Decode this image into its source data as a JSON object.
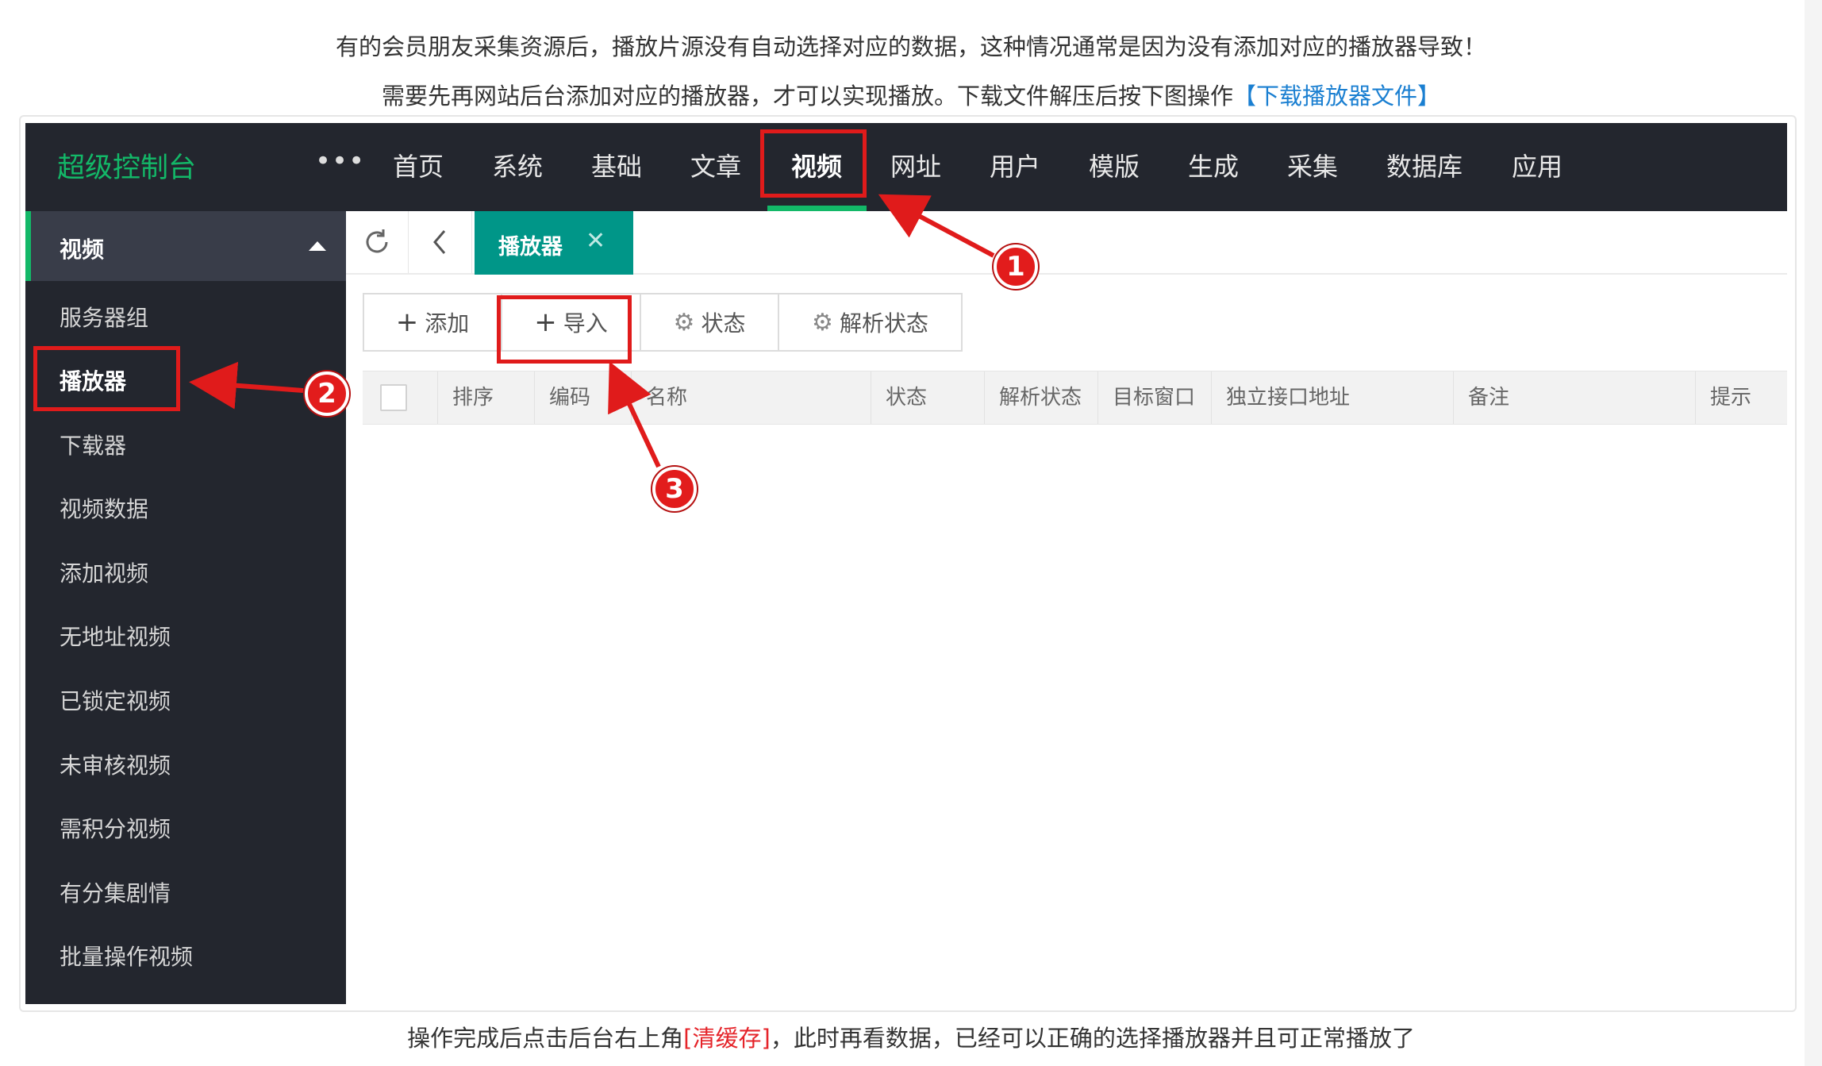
{
  "article": {
    "line1": "有的会员朋友采集资源后，播放片源没有自动选择对应的数据，这种情况通常是因为没有添加对应的播放器导致！",
    "line2_text": "需要先再网站后台添加对应的播放器，才可以实现播放。下载文件解压后按下图操作",
    "line2_link": "【下载播放器文件】",
    "outro_pre": "操作完成后点击后台右上角",
    "outro_red": "[清缓存]",
    "outro_post": "，此时再看数据，已经可以正确的选择播放器并且可正常播放了"
  },
  "header": {
    "brand": "超级控制台",
    "more": "•••",
    "nav": [
      "首页",
      "系统",
      "基础",
      "文章",
      "视频",
      "网址",
      "用户",
      "模版",
      "生成",
      "采集",
      "数据库",
      "应用"
    ],
    "active_nav": "视频"
  },
  "sidebar": {
    "section_title": "视频",
    "items": [
      "服务器组",
      "播放器",
      "下载器",
      "视频数据",
      "添加视频",
      "无地址视频",
      "已锁定视频",
      "未审核视频",
      "需积分视频",
      "有分集剧情",
      "批量操作视频"
    ],
    "active_item": "播放器"
  },
  "tabs": {
    "refresh_icon": "refresh-icon",
    "back_icon": "chevron-left-icon",
    "active_label": "播放器",
    "close_glyph": "✕"
  },
  "toolbar": {
    "add": "添加",
    "import": "导入",
    "status": "状态",
    "parse_status": "解析状态"
  },
  "table": {
    "columns": [
      "排序",
      "编码",
      "名称",
      "状态",
      "解析状态",
      "目标窗口",
      "独立接口地址",
      "备注",
      "提示"
    ]
  },
  "annotations": {
    "badges": [
      "1",
      "2",
      "3"
    ],
    "color": "#e01b1b"
  },
  "colors": {
    "accent": "#009688",
    "brand_green": "#13b868",
    "dark_bg": "#23262e",
    "link": "#1a7fd1"
  }
}
